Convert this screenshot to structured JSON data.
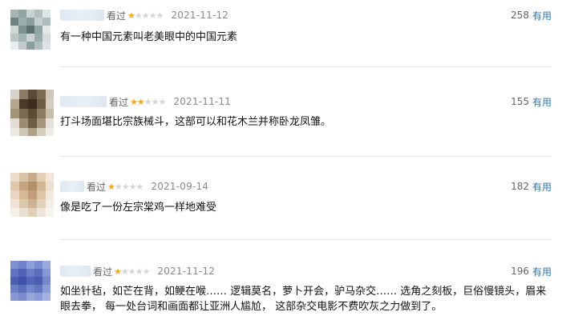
{
  "reviews": [
    {
      "status": "看过",
      "rating": 1,
      "date": "2021-11-12",
      "useful_count": "258",
      "useful_label": "有用",
      "content": "有一种中国元素叫老美眼中的中国元素",
      "avatar_colors": [
        "#a7b6b3",
        "#8fa6a1",
        "#c9d3d3",
        "#b1c0bd",
        "#dfe5e5",
        "#6e8582",
        "#9bb0ad",
        "#8a9e9b",
        "#c3cfcd",
        "#aebdbb",
        "#cfd8d6",
        "#7f9491",
        "#5d7270",
        "#91a6a3",
        "#e4e9e8",
        "#b8c6c4",
        "#a3b5b2",
        "#c9d4d2",
        "#99aca9",
        "#d6dedd",
        "#e8eded",
        "#bfcccb",
        "#8aa09d",
        "#b0bfbd",
        "#dce3e2"
      ]
    },
    {
      "status": "看过",
      "rating": 2,
      "date": "2021-11-11",
      "useful_count": "155",
      "useful_label": "有用",
      "content": "打斗场面堪比宗族械斗，这部可以和花木兰并称卧龙凤雏。",
      "avatar_colors": [
        "#d9d4cb",
        "#8c7b64",
        "#5b4a35",
        "#7a6a52",
        "#cfc7ba",
        "#b5a78f",
        "#4a3a28",
        "#3b2d1f",
        "#6d5c44",
        "#d3ccc0",
        "#a39478",
        "#7b6a4f",
        "#5c4b36",
        "#8c7b62",
        "#c7bca9",
        "#e2ddd4",
        "#9c8b70",
        "#6f5d44",
        "#a69680",
        "#e6e2da",
        "#ebe8e2",
        "#cfc5b4",
        "#b0a186",
        "#d6cebf",
        "#f0ede8"
      ]
    },
    {
      "status": "看过",
      "rating": 1,
      "date": "2021-09-14",
      "useful_count": "182",
      "useful_label": "有用",
      "content": "像是吃了一份左宗棠鸡一样地难受",
      "avatar_colors": [
        "#e9dccb",
        "#d9c3a6",
        "#c9ad8a",
        "#e2cfb6",
        "#f0e6d9",
        "#dec8aa",
        "#c6a47e",
        "#b58f66",
        "#d2b795",
        "#ecdfcd",
        "#e7d6c0",
        "#d4b994",
        "#c29f78",
        "#ddc5a6",
        "#f1e8dc",
        "#eee3d5",
        "#dcc7ab",
        "#cdb393",
        "#e3d2bb",
        "#f4ede4",
        "#f5efe7",
        "#ebdfcf",
        "#e1cfb7",
        "#efe5d8",
        "#f7f2ec"
      ]
    },
    {
      "status": "看过",
      "rating": 1,
      "date": "2021-11-12",
      "useful_count": "196",
      "useful_label": "有用",
      "content_lines": [
        "如坐针毡，如芒在背，如鲠在喉…… 逻辑莫名，萝卜开会，驴马杂交…… 选角之刻板，巨俗慢镜头，眉来",
        "眼去拳， 每一处台词和画面都让亚洲人尴尬， 这部杂交电影不费吹灰之力做到了。"
      ],
      "avatar_colors": [
        "#7d8fd1",
        "#6f82c9",
        "#8ea0d9",
        "#7a8dcf",
        "#9aaadf",
        "#5f73c0",
        "#4f64b6",
        "#6a7ec7",
        "#5b6fbe",
        "#8597d4",
        "#4c60b3",
        "#3f54a9",
        "#5468ba",
        "#4a5eb2",
        "#7688ca",
        "#6b7ec6",
        "#5a6ebd",
        "#7386ca",
        "#6376c2",
        "#8a9bd6",
        "#8798d5",
        "#7b8dd0",
        "#95a5dc",
        "#8a9cd7",
        "#a3b1e1"
      ]
    }
  ],
  "colors": {
    "star_on": "#f5a623",
    "star_off": "#d5d5d5",
    "link": "#3377aa"
  }
}
